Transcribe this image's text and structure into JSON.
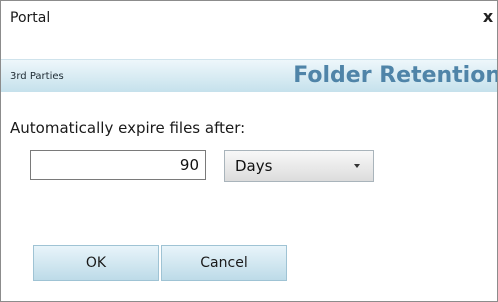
{
  "window": {
    "title": "Portal",
    "close_glyph": "x"
  },
  "header": {
    "section_label": "3rd Parties",
    "title": "Folder Retention"
  },
  "form": {
    "prompt": "Automatically expire files after:",
    "expire_value": "90",
    "unit_selected": "Days"
  },
  "buttons": {
    "ok_label": "OK",
    "cancel_label": "Cancel"
  },
  "colors": {
    "header_title": "#4f84a8",
    "header_band_top": "#eef7fb",
    "header_band_bottom": "#c5e1ec",
    "button_top": "#e8f4fa",
    "button_bottom": "#bddbe8"
  },
  "icons": {
    "close": "close-icon",
    "dropdown": "chevron-down-icon"
  }
}
